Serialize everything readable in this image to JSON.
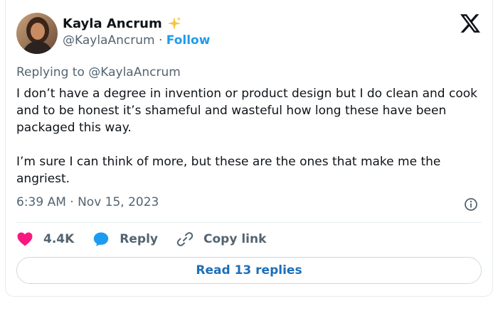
{
  "author": {
    "name": "Kayla Ancrum",
    "handle": "@KaylaAncrum",
    "separator": "·",
    "follow_label": "Follow"
  },
  "reply_context": {
    "text": "Replying to @KaylaAncrum"
  },
  "tweet": {
    "paragraphs": [
      "I don’t have a degree in invention or product design but I do clean and cook and to be honest it’s shameful and wasteful how long these have been packaged this way.",
      "I’m sure I can think of more, but these are the ones that make me the angriest."
    ],
    "timestamp": "6:39 AM · Nov 15, 2023"
  },
  "actions": {
    "likes": "4.4K",
    "reply_label": "Reply",
    "copy_link_label": "Copy link"
  },
  "read_replies_label": "Read 13 replies",
  "colors": {
    "accent": "#1d9bf0",
    "like": "#f91880",
    "muted": "#536471",
    "text": "#0f1419"
  },
  "icons": [
    "avatar",
    "sparkle-icon",
    "x-logo-icon",
    "info-icon",
    "heart-icon",
    "reply-bubble-icon",
    "link-icon"
  ]
}
